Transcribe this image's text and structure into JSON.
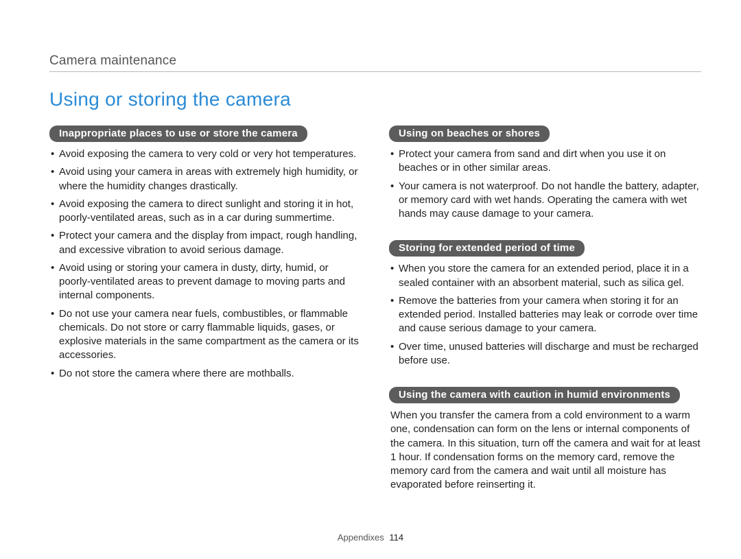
{
  "header": {
    "breadcrumb": "Camera maintenance"
  },
  "title": "Using or storing the camera",
  "left": {
    "section1": {
      "heading": "Inappropriate places to use or store the camera",
      "items": [
        "Avoid exposing the camera to very cold or very hot temperatures.",
        "Avoid using your camera in areas with extremely high humidity, or where the humidity changes drastically.",
        "Avoid exposing the camera to direct sunlight and storing it in hot, poorly-ventilated areas, such as in a car during summertime.",
        "Protect your camera and the display from impact, rough handling, and excessive vibration to avoid serious damage.",
        "Avoid using or storing your camera in dusty, dirty, humid, or poorly-ventilated areas to prevent damage to moving parts and internal components.",
        "Do not use your camera near fuels, combustibles, or flammable chemicals. Do not store or carry flammable liquids, gases, or explosive materials in the same compartment as the camera or its accessories.",
        "Do not store the camera where there are mothballs."
      ]
    }
  },
  "right": {
    "section1": {
      "heading": "Using on beaches or shores",
      "items": [
        "Protect your camera from sand and dirt when you use it on beaches or in other similar areas.",
        "Your camera is not waterproof. Do not handle the battery, adapter, or memory card with wet hands. Operating the camera with wet hands may cause damage to your camera."
      ]
    },
    "section2": {
      "heading": "Storing for extended period of time",
      "items": [
        "When you store the camera for an extended period, place it in a sealed container with an absorbent material, such as silica gel.",
        "Remove the batteries from your camera when storing it for an extended period. Installed batteries may leak or corrode over time and cause serious damage to your camera.",
        "Over time, unused batteries will discharge and must be recharged before use."
      ]
    },
    "section3": {
      "heading": "Using the camera with caution in humid environments",
      "paragraph": "When you transfer the camera from a cold environment to a warm one, condensation can form on the lens or internal components of the camera. In this situation, turn off the camera and wait for at least 1 hour. If condensation forms on the memory card, remove the memory card from the camera and wait until all moisture has evaporated before reinserting it."
    }
  },
  "footer": {
    "section": "Appendixes",
    "page": "114"
  }
}
